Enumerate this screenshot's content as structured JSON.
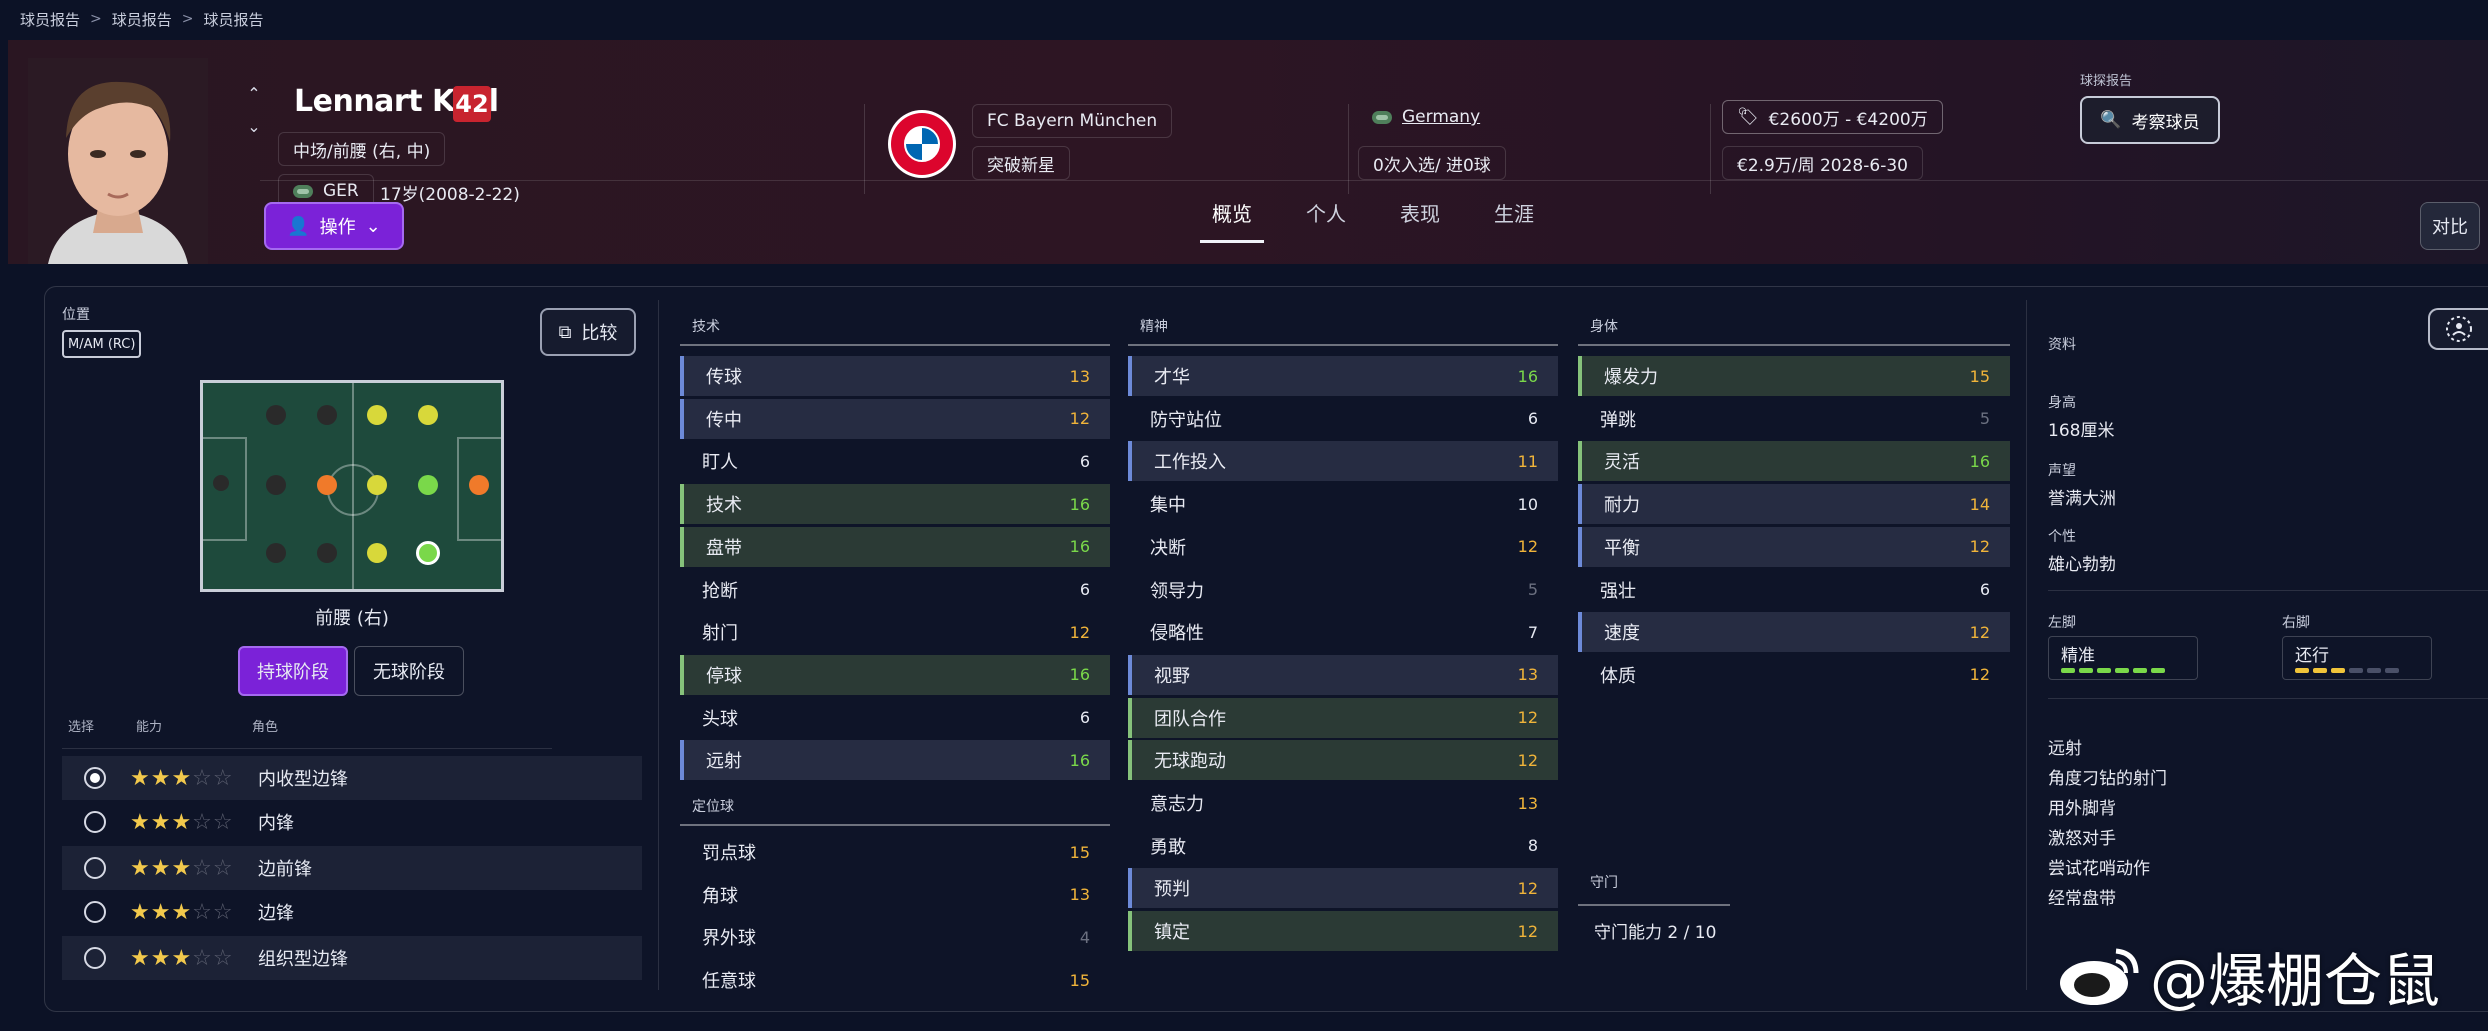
{
  "breadcrumb": [
    "球员报告",
    "球员报告",
    "球员报告"
  ],
  "player": {
    "name": "Lennart Karl",
    "number": "42",
    "position": "中场/前腰 (右, 中)",
    "nation_code": "GER",
    "age": "17岁(2008-2-22)"
  },
  "club": {
    "name": "FC Bayern München",
    "status": "突破新星"
  },
  "nation": {
    "name": "Germany",
    "caps": "0次入选/ 进0球"
  },
  "value": {
    "range": "€2600万 - €4200万",
    "wage": "€2.9万/周  2028-6-30"
  },
  "scout": {
    "label": "球探报告",
    "button": "考察球员"
  },
  "action_button": "操作",
  "tabs": [
    "概览",
    "个人",
    "表现",
    "生涯"
  ],
  "compare_top": "对比",
  "position_panel": {
    "label": "位置",
    "code": "M/AM (RC)",
    "compare_button": "比较",
    "selected_position": "前腰 (右)",
    "phases": [
      "持球阶段",
      "无球阶段"
    ],
    "dot_colors": {
      "none": "#2a2a2a",
      "orange": "#f07a2a",
      "yellow": "#d8d83a",
      "green": "#7ad84a"
    }
  },
  "roles": {
    "headers": [
      "选择",
      "能力",
      "角色"
    ],
    "items": [
      {
        "name": "内收型边锋",
        "stars": 2.5,
        "selected": true
      },
      {
        "name": "内锋",
        "stars": 2.5,
        "selected": false
      },
      {
        "name": "边前锋",
        "stars": 2.5,
        "selected": false
      },
      {
        "name": "边锋",
        "stars": 2.5,
        "selected": false
      },
      {
        "name": "组织型边锋",
        "stars": 2.5,
        "selected": false
      }
    ]
  },
  "attributes": {
    "technical": {
      "title": "技术",
      "items": [
        {
          "name": "传球",
          "value": "13"
        },
        {
          "name": "传中",
          "value": "12"
        },
        {
          "name": "盯人",
          "value": "6"
        },
        {
          "name": "技术",
          "value": "16"
        },
        {
          "name": "盘带",
          "value": "16"
        },
        {
          "name": "抢断",
          "value": "6"
        },
        {
          "name": "射门",
          "value": "12"
        },
        {
          "name": "停球",
          "value": "16"
        },
        {
          "name": "头球",
          "value": "6"
        },
        {
          "name": "远射",
          "value": "16"
        }
      ]
    },
    "set_pieces": {
      "title": "定位球",
      "items": [
        {
          "name": "罚点球",
          "value": "15"
        },
        {
          "name": "角球",
          "value": "13"
        },
        {
          "name": "界外球",
          "value": "4"
        },
        {
          "name": "任意球",
          "value": "15"
        }
      ]
    },
    "mental": {
      "title": "精神",
      "items": [
        {
          "name": "才华",
          "value": "16"
        },
        {
          "name": "防守站位",
          "value": "6"
        },
        {
          "name": "工作投入",
          "value": "11"
        },
        {
          "name": "集中",
          "value": "10"
        },
        {
          "name": "决断",
          "value": "12"
        },
        {
          "name": "领导力",
          "value": "5"
        },
        {
          "name": "侵略性",
          "value": "7"
        },
        {
          "name": "视野",
          "value": "13"
        },
        {
          "name": "团队合作",
          "value": "12"
        },
        {
          "name": "无球跑动",
          "value": "12"
        },
        {
          "name": "意志力",
          "value": "13"
        },
        {
          "name": "勇敢",
          "value": "8"
        },
        {
          "name": "预判",
          "value": "12"
        },
        {
          "name": "镇定",
          "value": "12"
        }
      ]
    },
    "physical": {
      "title": "身体",
      "items": [
        {
          "name": "爆发力",
          "value": "15"
        },
        {
          "name": "弹跳",
          "value": "5"
        },
        {
          "name": "灵活",
          "value": "16"
        },
        {
          "name": "耐力",
          "value": "14"
        },
        {
          "name": "平衡",
          "value": "12"
        },
        {
          "name": "强壮",
          "value": "6"
        },
        {
          "name": "速度",
          "value": "12"
        },
        {
          "name": "体质",
          "value": "12"
        }
      ]
    },
    "goalkeeping": {
      "title": "守门",
      "value": "守门能力 2 / 10"
    }
  },
  "colors": {
    "high": "#7ad84a",
    "mid": "#f0b43a",
    "low": "#e6e9f2",
    "dim": "#6b7080"
  },
  "info": {
    "title": "资料",
    "height_label": "身高",
    "height": "168厘米",
    "reputation_label": "声望",
    "reputation": "誉满大洲",
    "personality_label": "个性",
    "personality": "雄心勃勃",
    "left_foot_label": "左脚",
    "left_foot": "精准",
    "left_foot_level": 6,
    "right_foot_label": "右脚",
    "right_foot": "还行",
    "right_foot_level": 3,
    "traits": [
      "远射",
      "角度刁钻的射门",
      "用外脚背",
      "激怒对手",
      "尝试花哨动作",
      "经常盘带"
    ]
  },
  "watermark": "@爆棚仓鼠"
}
